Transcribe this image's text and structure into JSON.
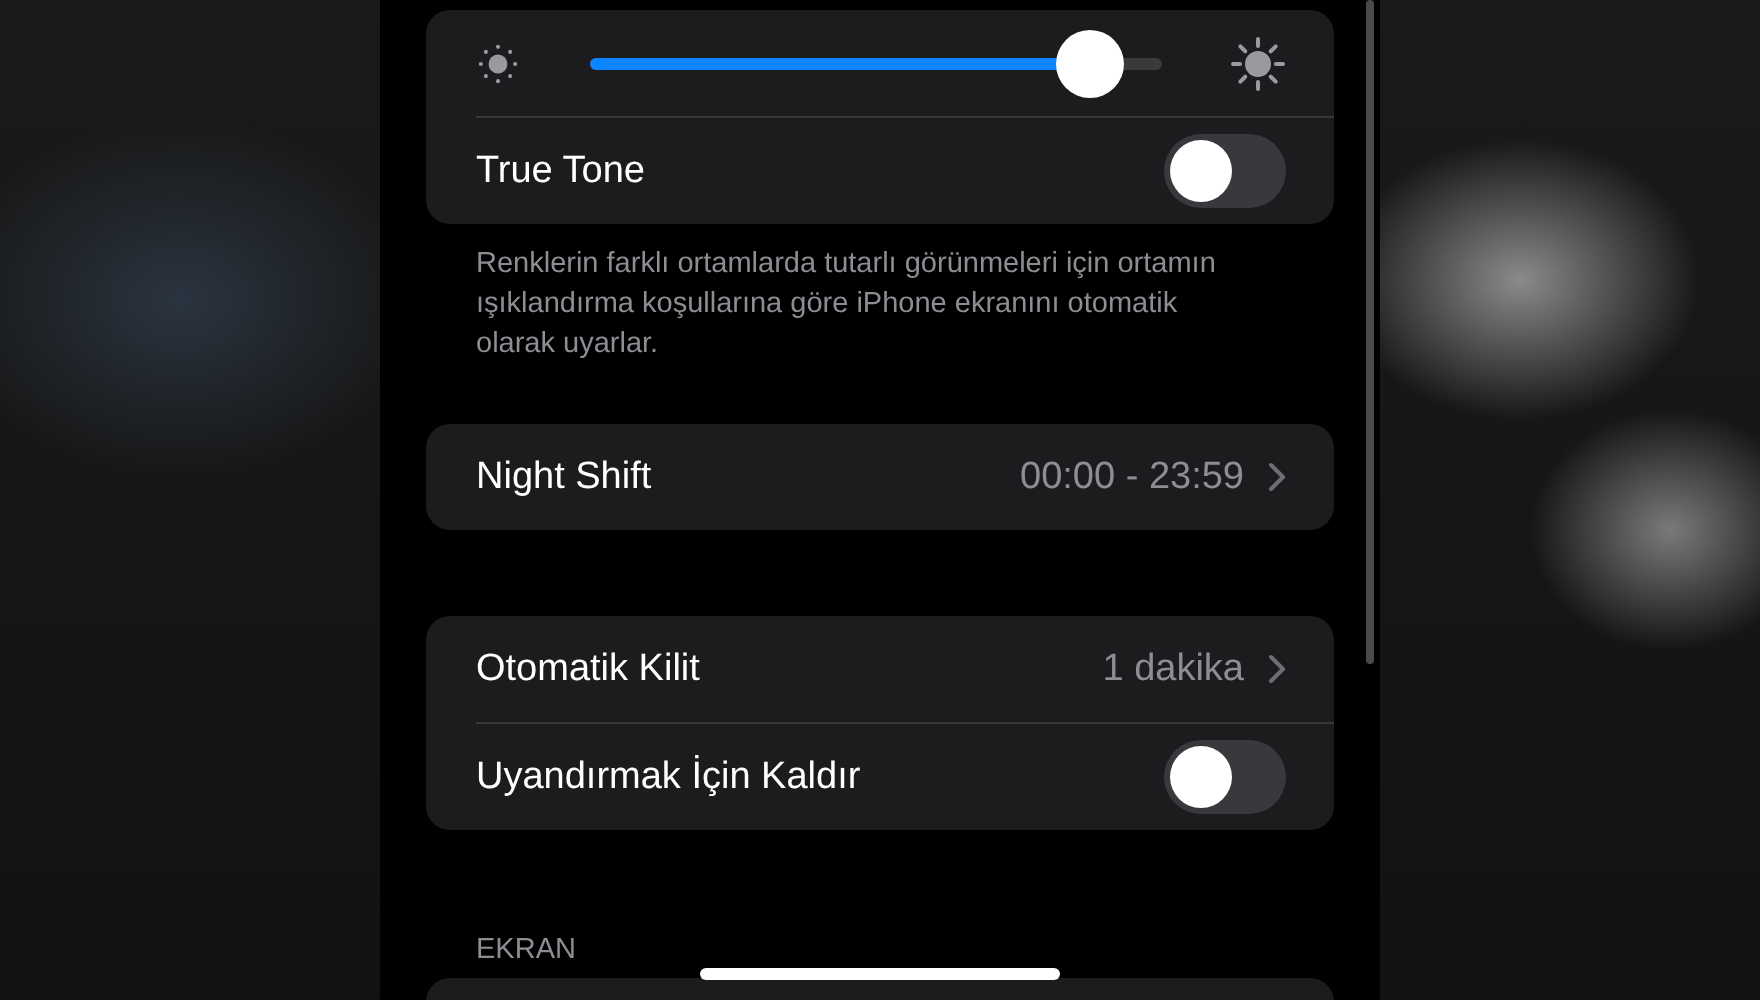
{
  "sections": [
    {
      "rows": [
        {
          "kind": "slider",
          "level": 0.875
        },
        {
          "kind": "toggle",
          "label": "True Tone",
          "on": false
        }
      ],
      "footer": "Renklerin farklı ortamlarda tutarlı görünmeleri için ortamın ışıklandırma koşullarına göre iPhone ekranını otomatik olarak uyarlar."
    },
    {
      "rows": [
        {
          "kind": "link",
          "label": "Night Shift",
          "value": "00:00 - 23:59"
        }
      ]
    },
    {
      "rows": [
        {
          "kind": "link",
          "label": "Otomatik Kilit",
          "value": "1 dakika"
        },
        {
          "kind": "toggle",
          "label": "Uyandırmak İçin Kaldır",
          "on": false
        }
      ]
    },
    {
      "header": "EKRAN"
    }
  ]
}
